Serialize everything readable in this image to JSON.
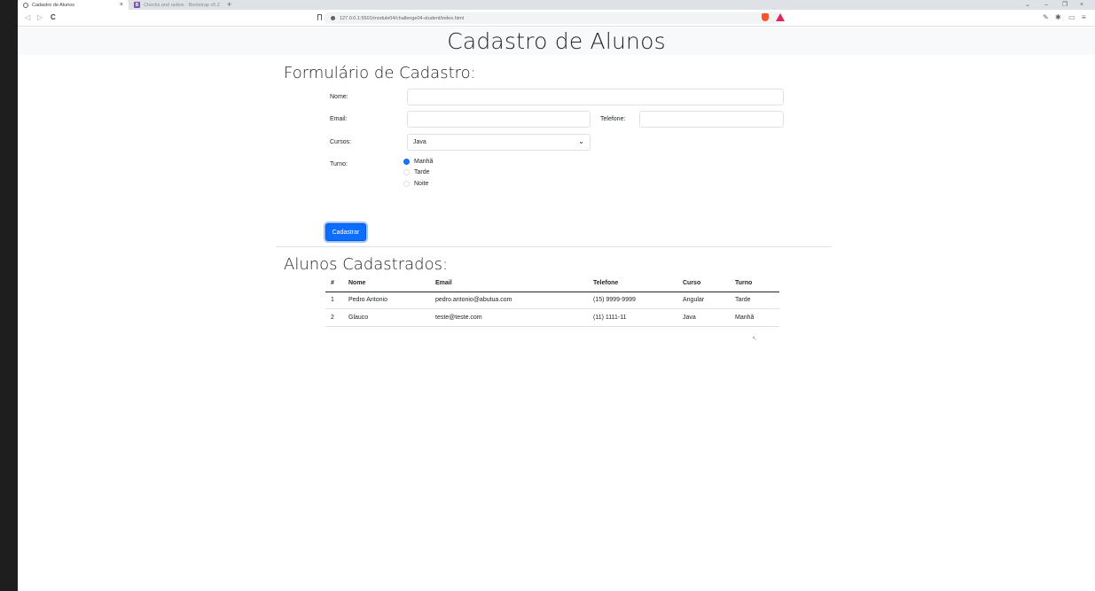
{
  "browser": {
    "tabs": [
      {
        "title": "Cadastro de Alunos",
        "active": true
      },
      {
        "title": "Checks and radios · Bootstrap v5.2",
        "active": false
      }
    ],
    "url": "127.0.0.1:5501/module04/challenge04-student/index.html",
    "close_glyph": "×",
    "new_tab_glyph": "+",
    "nav": {
      "back": "◁",
      "forward": "▷",
      "reload": "C"
    }
  },
  "page": {
    "heading": "Cadastro de Alunos",
    "form": {
      "title": "Formulário de Cadastro:",
      "nome_label": "Nome:",
      "nome_value": "",
      "email_label": "Email:",
      "email_value": "",
      "telefone_label": "Telefone:",
      "telefone_value": "",
      "cursos_label": "Cursos:",
      "cursos_selected": "Java",
      "turno_label": "Turno:",
      "turnos": [
        {
          "label": "Manhã",
          "checked": true
        },
        {
          "label": "Tarde",
          "checked": false
        },
        {
          "label": "Noite",
          "checked": false
        }
      ],
      "submit_label": "Cadastrar"
    },
    "list": {
      "title": "Alunos Cadastrados:",
      "columns": [
        "#",
        "Nome",
        "Email",
        "Telefone",
        "Curso",
        "Turno"
      ],
      "rows": [
        [
          "1",
          "Pedro Antonio",
          "pedro.antonio@abutua.com",
          "(15) 9999-9999",
          "Angular",
          "Tarde"
        ],
        [
          "2",
          "Glauco",
          "teste@teste.com",
          "(11) 1111-11",
          "Java",
          "Manhã"
        ]
      ]
    }
  },
  "colors": {
    "primary": "#0d6efd",
    "hero_bg": "#f8f9fa"
  }
}
